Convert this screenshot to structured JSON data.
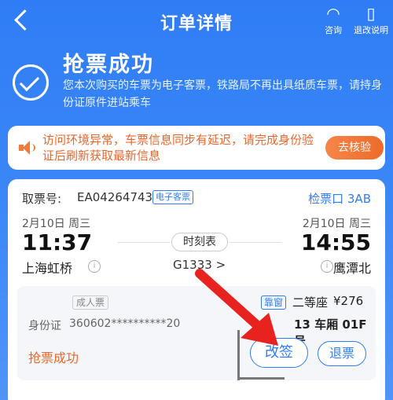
{
  "header": {
    "title": "订单详情",
    "consult_label": "咨询",
    "rule_label": "退改说明"
  },
  "success": {
    "title": "抢票成功",
    "description": "您本次购买的车票为电子客票，铁路局不再出具纸质车票，请持身份证原件进站乘车"
  },
  "notice": {
    "text": "访问环境异常，车票信息同步有延迟，请完成身份验证后刷新获取最新信息",
    "button_label": "去核验"
  },
  "ticket": {
    "ticket_no_label": "取票号:",
    "ticket_no": "EA04264743",
    "eticket_tag": "电子客票",
    "gate": "检票口 3AB",
    "departure": {
      "date": "2月10日  周三",
      "time": "11:37",
      "station": "上海虹桥"
    },
    "arrival": {
      "date": "2月10日  周三",
      "time": "14:55",
      "station": "鹰潭北"
    },
    "timetable_label": "时刻表",
    "train_no": "G1333 >",
    "passenger": {
      "ticket_type": "成人票",
      "id_label": "身份证",
      "id_value": "360602**********20",
      "window_tag": "靠窗",
      "seat_class": "二等座",
      "price": "¥276",
      "coach_seat": "13 车厢 01F 号",
      "status": "抢票成功",
      "change_label": "改签",
      "refund_label": "退票"
    }
  },
  "colors": {
    "brand_blue": "#2f7df6",
    "warning_orange": "#e9672c",
    "annotation_red": "#e8231f"
  }
}
